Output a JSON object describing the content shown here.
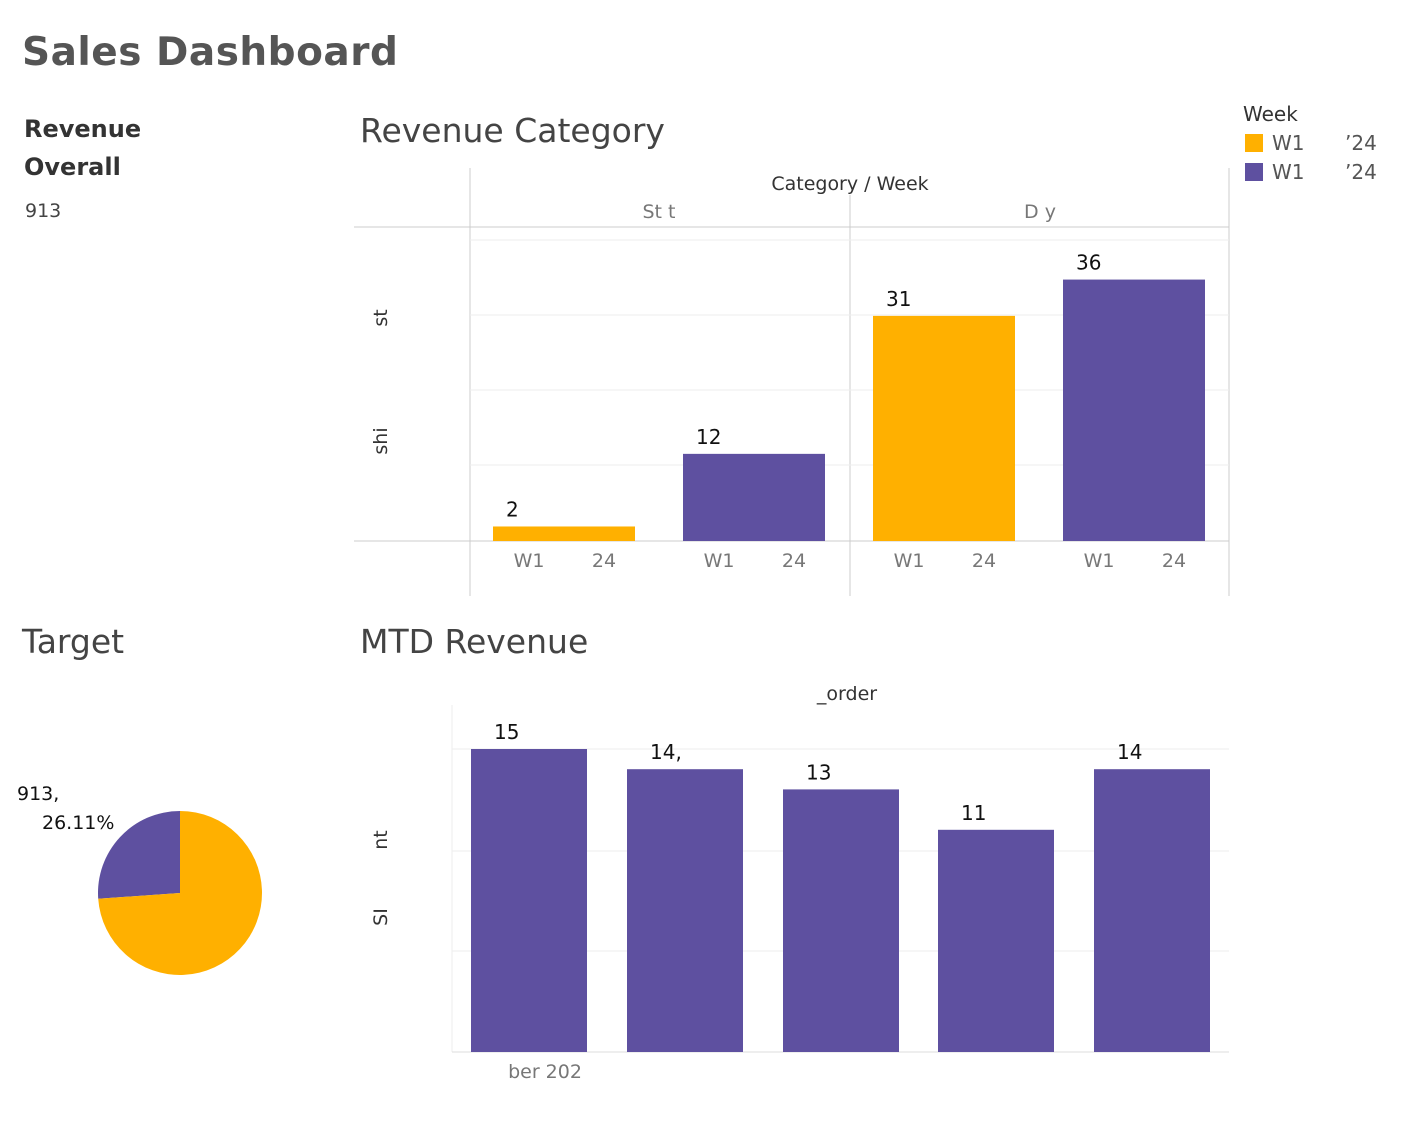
{
  "dashboard": {
    "title": "Sales Dashboard"
  },
  "kpi": {
    "title": "Revenue Overall",
    "value": "913"
  },
  "revenue_category": {
    "title": "Revenue Category",
    "header": "Category / Week",
    "y_labels": [
      "st",
      "shi"
    ]
  },
  "legend": {
    "title": "Week",
    "items": [
      {
        "label": "W1",
        "suffix": "’24",
        "color": "#FFB000"
      },
      {
        "label": "W1",
        "suffix": "’24",
        "color": "#5E50A0"
      }
    ]
  },
  "target": {
    "title": "Target",
    "value_label": "913,",
    "percent_label": "26.11%"
  },
  "mtd": {
    "title": "MTD Revenue",
    "header": "_order",
    "y_labels": [
      "nt",
      "SI"
    ],
    "x_label": "ber 202"
  },
  "colors": {
    "orange": "#FFB000",
    "purple": "#5E50A0",
    "grid": "#EEEEEE",
    "divider": "#CCCCCC"
  },
  "chart_data": [
    {
      "type": "bar",
      "title": "Revenue Category",
      "header": "Category / Week",
      "panels": [
        "St t",
        "D y"
      ],
      "categories": [
        "W1 24",
        "W1 24",
        "W1 24",
        "W1 24"
      ],
      "values": [
        2,
        12,
        31,
        36
      ],
      "value_labels": [
        "2",
        "12",
        "31",
        "36"
      ],
      "panel_index": [
        0,
        0,
        1,
        1
      ],
      "colors": [
        "#FFB000",
        "#5E50A0",
        "#FFB000",
        "#5E50A0"
      ],
      "ylim": [
        0,
        42
      ],
      "legend": "top-right",
      "grid": true
    },
    {
      "type": "pie",
      "title": "Target",
      "values": [
        26.11,
        73.89
      ],
      "labels": [
        "26.11%",
        ""
      ],
      "colors": [
        "#5E50A0",
        "#FFB000"
      ]
    },
    {
      "type": "bar",
      "title": "MTD Revenue",
      "header": "_order",
      "categories": [
        "ber 202",
        "",
        "",
        "",
        ""
      ],
      "values": [
        15,
        14,
        13,
        11,
        14
      ],
      "value_labels": [
        "15",
        "14,",
        "13",
        "11",
        "14"
      ],
      "colors": [
        "#5E50A0",
        "#5E50A0",
        "#5E50A0",
        "#5E50A0",
        "#5E50A0"
      ],
      "ylim": [
        0,
        15
      ],
      "grid": true
    }
  ]
}
